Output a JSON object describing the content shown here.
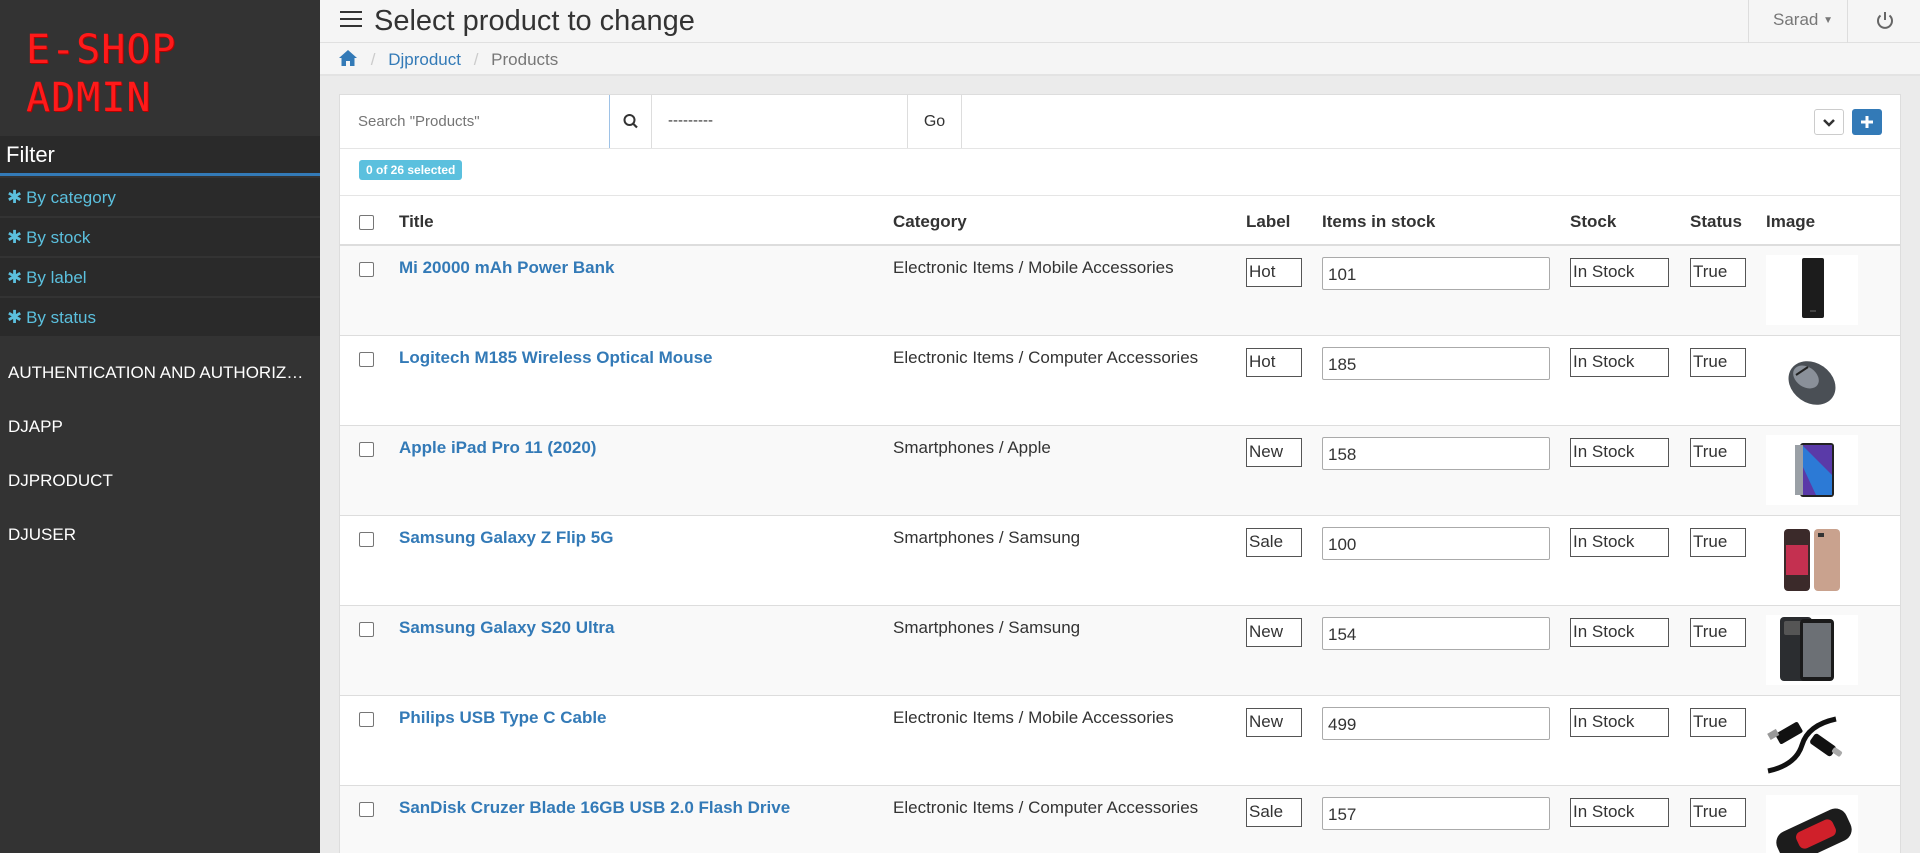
{
  "sidebar": {
    "logo_line1": "E-SHOP",
    "logo_line2": "ADMIN",
    "filter_title": "Filter",
    "filters": [
      "By category",
      "By stock",
      "By label",
      "By status"
    ],
    "apps": [
      "AUTHENTICATION AND AUTHORIZATION",
      "DJAPP",
      "DJPRODUCT",
      "DJUSER"
    ]
  },
  "header": {
    "title": "Select product to change",
    "user": "Sarad"
  },
  "breadcrumb": {
    "app": "Djproduct",
    "current": "Products"
  },
  "toolbar": {
    "search_placeholder": "Search \"Products\"",
    "action_value": "---------",
    "go_label": "Go"
  },
  "selection": {
    "text": "0 of 26 selected"
  },
  "table": {
    "columns": [
      "Title",
      "Category",
      "Label",
      "Items in stock",
      "Stock",
      "Status",
      "Image"
    ],
    "rows": [
      {
        "title": "Mi 20000 mAh Power Bank",
        "category": "Electronic Items / Mobile Accessories",
        "label": "Hot",
        "qty": "101",
        "stock": "In Stock",
        "status": "True",
        "image": "power-bank"
      },
      {
        "title": "Logitech M185 Wireless Optical Mouse",
        "category": "Electronic Items / Computer Accessories",
        "label": "Hot",
        "qty": "185",
        "stock": "In Stock",
        "status": "True",
        "image": "mouse"
      },
      {
        "title": "Apple iPad Pro 11 (2020)",
        "category": "Smartphones / Apple",
        "label": "New",
        "qty": "158",
        "stock": "In Stock",
        "status": "True",
        "image": "tablet"
      },
      {
        "title": "Samsung Galaxy Z Flip 5G",
        "category": "Smartphones / Samsung",
        "label": "Sale",
        "qty": "100",
        "stock": "In Stock",
        "status": "True",
        "image": "flip-phone"
      },
      {
        "title": "Samsung Galaxy S20 Ultra",
        "category": "Smartphones / Samsung",
        "label": "New",
        "qty": "154",
        "stock": "In Stock",
        "status": "True",
        "image": "phone"
      },
      {
        "title": "Philips USB Type C Cable",
        "category": "Electronic Items / Mobile Accessories",
        "label": "New",
        "qty": "499",
        "stock": "In Stock",
        "status": "True",
        "image": "usb-cable"
      },
      {
        "title": "SanDisk Cruzer Blade 16GB USB 2.0 Flash Drive",
        "category": "Electronic Items / Computer Accessories",
        "label": "Sale",
        "qty": "157",
        "stock": "In Stock",
        "status": "True",
        "image": "flash-drive"
      }
    ]
  },
  "colors": {
    "sidebar_bg": "#333333",
    "logo": "#ff1a1a",
    "link": "#337ab7",
    "filter_link": "#5bc0de"
  }
}
